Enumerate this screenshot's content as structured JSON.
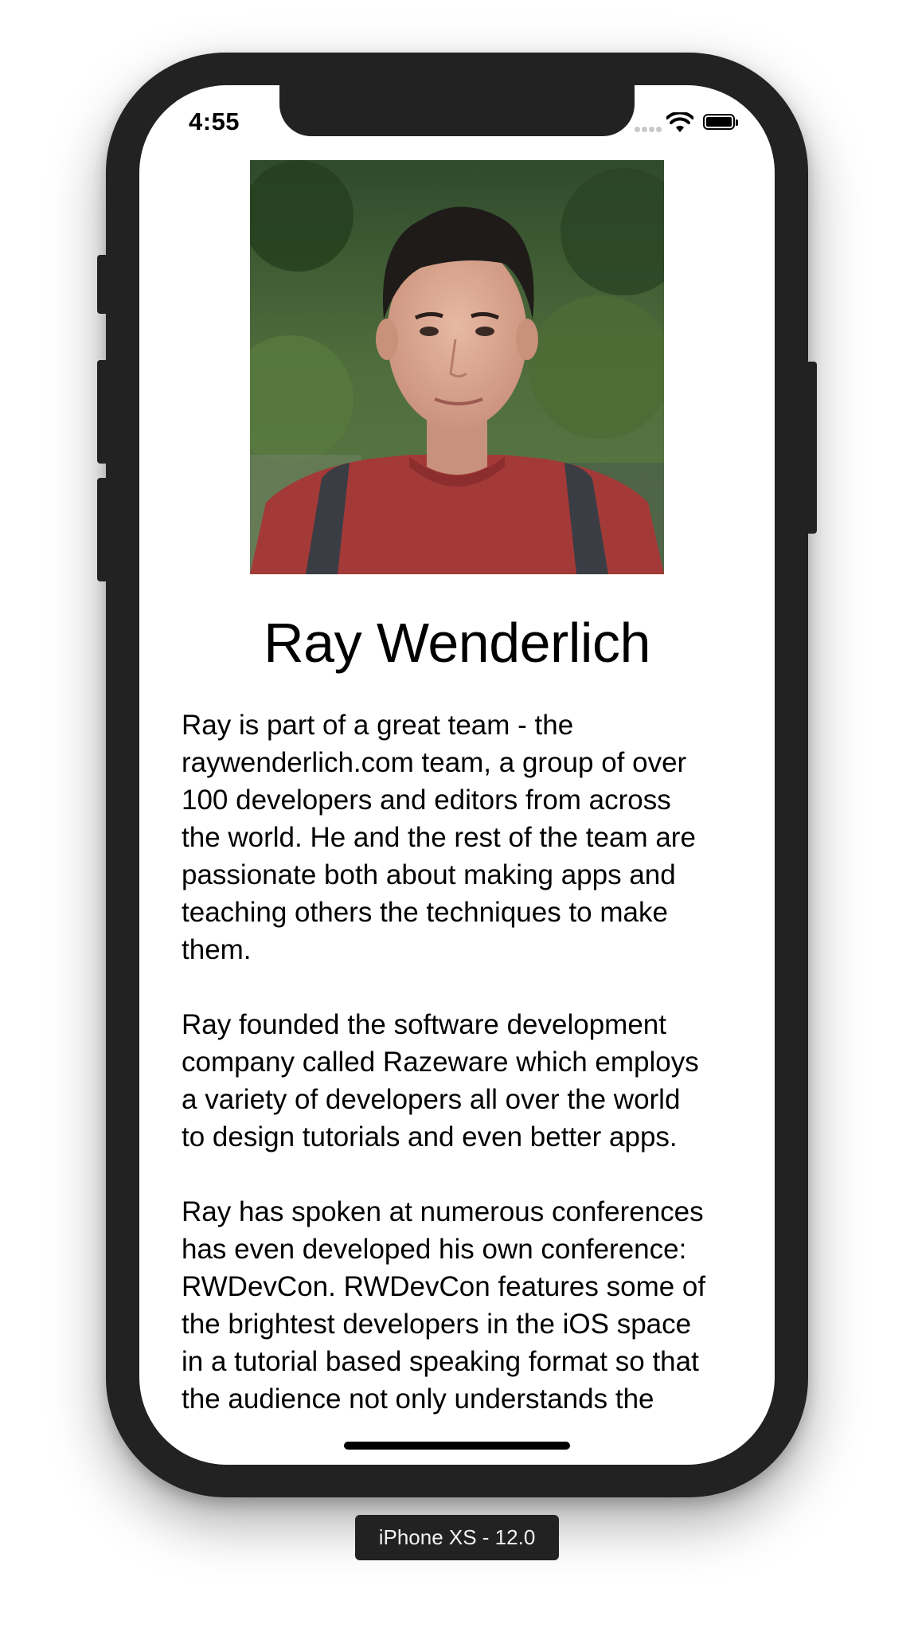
{
  "status_bar": {
    "time": "4:55",
    "icons": [
      "signal-dots-icon",
      "wifi-icon",
      "battery-icon"
    ]
  },
  "profile": {
    "photo_alt": "Ray Wenderlich",
    "name": "Ray Wenderlich",
    "bio_paragraphs": [
      [
        "Ray is part of a great team - the",
        "raywenderlich.com team, a group of over",
        "100 developers and editors from across",
        "the world. He and the rest of the team are",
        "passionate both about making apps and",
        "teaching others the techniques to make",
        "them."
      ],
      [
        "Ray founded the software development",
        "company called Razeware which employs",
        "a variety of developers all over the world",
        "to design tutorials and even better apps."
      ],
      [
        "Ray has spoken at numerous conferences",
        "has even developed his own conference:",
        "RWDevCon. RWDevCon features some of",
        "the brightest developers in the iOS space",
        "in a tutorial based speaking format so that",
        "the audience not only understands the"
      ]
    ]
  },
  "simulator": {
    "device_label": "iPhone XS - 12.0"
  },
  "colors": {
    "device_frame": "#222222",
    "screen_background": "#ffffff",
    "text": "#000000",
    "label_background": "#222222",
    "label_text": "#f2f2f2"
  }
}
